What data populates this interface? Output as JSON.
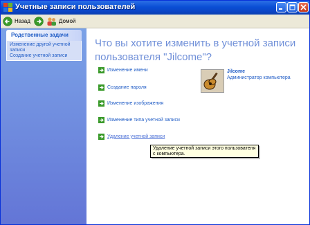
{
  "window": {
    "title": "Учетные записи пользователей"
  },
  "toolbar": {
    "back_label": "Назад",
    "home_label": "Домой"
  },
  "sidebar": {
    "panel_title": "Родственные задачи",
    "links": [
      "Изменение другой учетной записи",
      "Создание учетной записи"
    ]
  },
  "main": {
    "heading": "Что вы хотите изменить в учетной записи пользователя \"Jilcome\"?",
    "actions": [
      "Изменение имени",
      "Создание пароля",
      "Изменение изображения",
      "Изменение типа учетной записи",
      "Удаление учетной записи"
    ]
  },
  "user": {
    "name": "Jilcome",
    "role": "Администратор компьютера",
    "picture_icon": "guitar-icon"
  },
  "tooltip": {
    "text": "Удаление учетной записи этого пользователя с компьютера."
  },
  "colors": {
    "title_bar": "#0a4fd5",
    "link": "#215dc6",
    "heading": "#6f8fd8",
    "sidebar": "#6f8fe0",
    "tooltip_bg": "#ffffe1",
    "action_arrow": "#3a9a2a"
  }
}
